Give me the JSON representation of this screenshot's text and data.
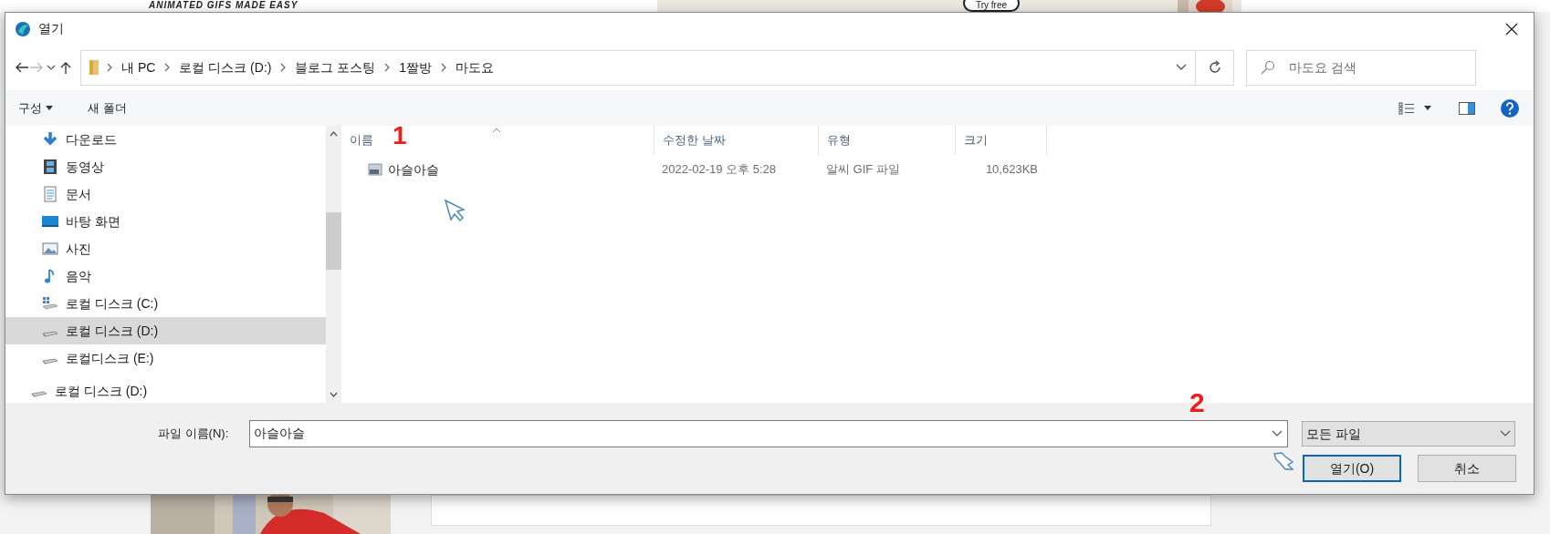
{
  "background": {
    "logo_tagline": "ANIMATED GIFS MADE EASY",
    "ad_button": "Try free"
  },
  "window": {
    "title": "열기"
  },
  "address_bar": {
    "path": [
      {
        "label": "내 PC"
      },
      {
        "label": "로컬 디스크 (D:)"
      },
      {
        "label": "블로그 포스팅"
      },
      {
        "label": "1짤방"
      },
      {
        "label": "마도요"
      }
    ],
    "search_placeholder": "마도요 검색"
  },
  "toolbar": {
    "organize": "구성",
    "new_folder": "새 폴더"
  },
  "sidebar": {
    "groups": [
      {
        "items": [
          {
            "label": "다운로드",
            "kind": "download",
            "selected": false
          },
          {
            "label": "동영상",
            "kind": "video",
            "selected": false
          },
          {
            "label": "문서",
            "kind": "document",
            "selected": false
          },
          {
            "label": "바탕 화면",
            "kind": "desktop",
            "selected": false
          },
          {
            "label": "사진",
            "kind": "pictures",
            "selected": false
          },
          {
            "label": "음악",
            "kind": "music",
            "selected": false
          },
          {
            "label": "로컬 디스크 (C:)",
            "kind": "system-drive",
            "selected": false
          },
          {
            "label": "로컬 디스크 (D:)",
            "kind": "drive",
            "selected": true
          },
          {
            "label": "로컬디스크 (E:)",
            "kind": "drive",
            "selected": false
          }
        ]
      },
      {
        "items": [
          {
            "label": "로컬 디스크 (D:)",
            "kind": "drive",
            "selected": false
          }
        ]
      }
    ]
  },
  "table": {
    "columns": [
      "이름",
      "수정한 날짜",
      "유형",
      "크기"
    ],
    "rows": [
      {
        "name": "아슬아슬",
        "modified": "2022-02-19 오후 5:28",
        "type": "알씨 GIF 파일",
        "size": "10,623KB"
      }
    ]
  },
  "footer": {
    "filename_label": "파일 이름(N):",
    "filename": "아슬아슬",
    "filter": "모든 파일",
    "buttons": [
      {
        "label": "열기(O)",
        "default": true
      },
      {
        "label": "취소",
        "default": false
      }
    ]
  },
  "annotations": [
    "1",
    "2"
  ]
}
